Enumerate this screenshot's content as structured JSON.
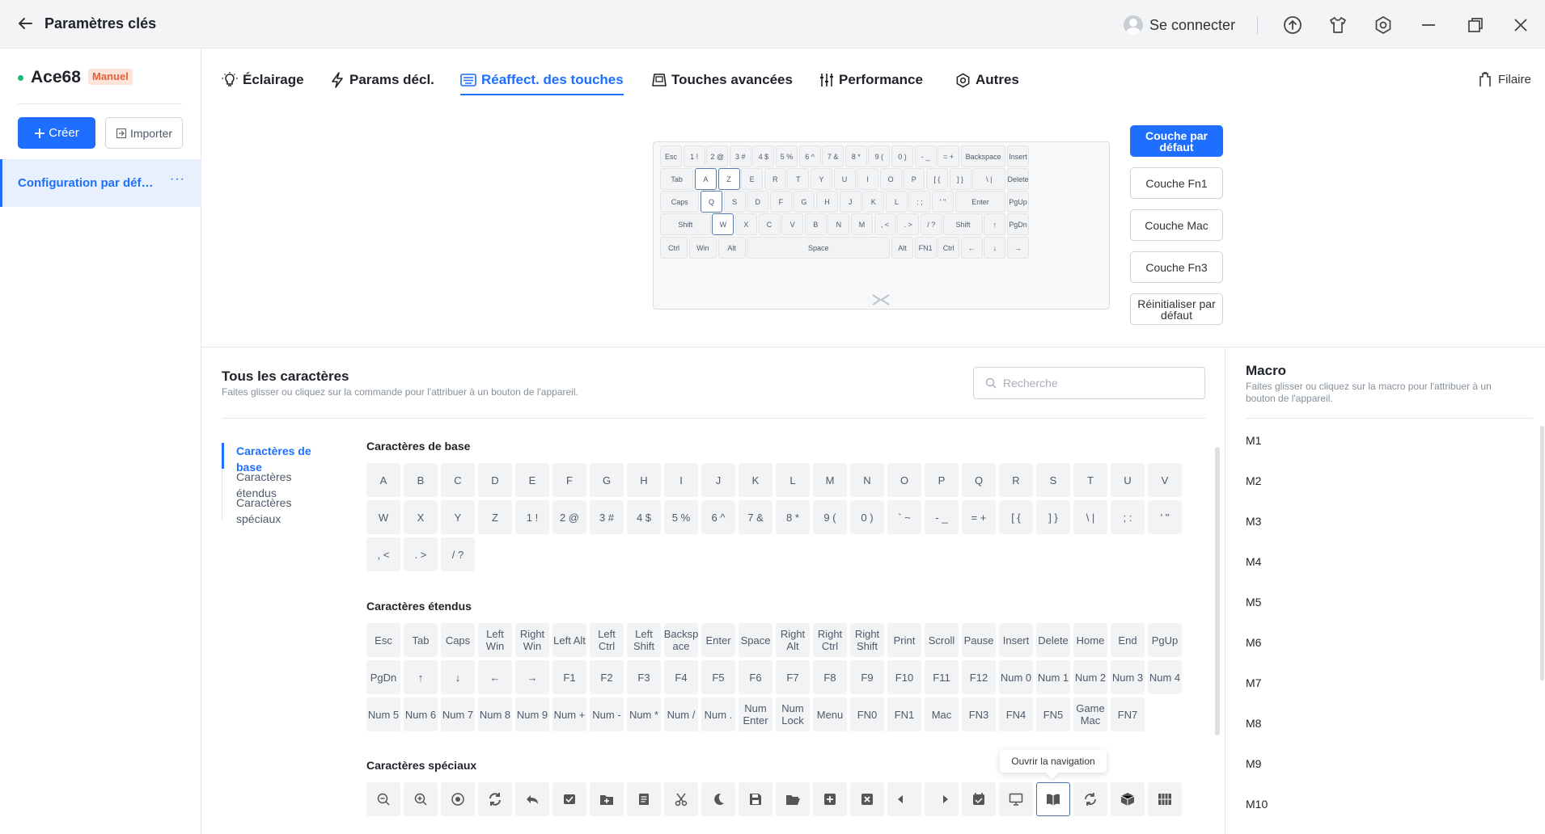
{
  "titlebar": {
    "title": "Paramètres clés",
    "user_label": "Se connecter"
  },
  "sidebar": {
    "device_name": "Ace68",
    "device_badge": "Manuel",
    "create_label": "Créer",
    "import_label": "Importer",
    "config_label": "Configuration par défaut",
    "config_more": "···"
  },
  "tabs": [
    {
      "label": "Éclairage",
      "icon": "bulb-icon"
    },
    {
      "label": "Params décl.",
      "icon": "bolt-icon"
    },
    {
      "label": "Réaffect. des touches",
      "icon": "keyboard-icon",
      "active": true
    },
    {
      "label": "Touches avancées",
      "icon": "keycap-icon"
    },
    {
      "label": "Performance",
      "icon": "sliders-icon"
    },
    {
      "label": "Autres",
      "icon": "hexagon-settings-icon"
    }
  ],
  "filaire_label": "Filaire",
  "keyboard": {
    "rows": [
      [
        "Esc",
        "1 !",
        "2 @",
        "3 #",
        "4 $",
        "5 %",
        "6 ^",
        "7 &",
        "8 *",
        "9 (",
        "0 )",
        "- _",
        "= +",
        "Backspace",
        "Insert"
      ],
      [
        "Tab",
        "A",
        "Z",
        "E",
        "R",
        "T",
        "Y",
        "U",
        "I",
        "O",
        "P",
        "[ {",
        "] }",
        "\\ |",
        "Delete"
      ],
      [
        "Caps",
        "Q",
        "S",
        "D",
        "F",
        "G",
        "H",
        "J",
        "K",
        "L",
        ": ;",
        "' \"",
        "Enter",
        "PgUp"
      ],
      [
        "Shift",
        "W",
        "X",
        "C",
        "V",
        "B",
        "N",
        "M",
        ", <",
        ". >",
        "/ ?",
        "Shift",
        "↑",
        "PgDn"
      ],
      [
        "Ctrl",
        "Win",
        "Alt",
        "Space",
        "Alt",
        "FN1",
        "Ctrl",
        "←",
        "↓",
        "→"
      ]
    ]
  },
  "layers": [
    {
      "label": "Couche par défaut",
      "active": true
    },
    {
      "label": "Couche Fn1"
    },
    {
      "label": "Couche Mac"
    },
    {
      "label": "Couche Fn3"
    },
    {
      "label": "Réinitialiser par défaut"
    }
  ],
  "chars_panel": {
    "title": "Tous les caractères",
    "subtitle": "Faites glisser ou cliquez sur la commande pour l'attribuer à un bouton de l'appareil.",
    "search_placeholder": "Recherche",
    "categories": [
      "Caractères de base",
      "Caractères étendus",
      "Caractères spéciaux"
    ],
    "basic_title": "Caractères de base",
    "basic": [
      "A",
      "B",
      "C",
      "D",
      "E",
      "F",
      "G",
      "H",
      "I",
      "J",
      "K",
      "L",
      "M",
      "N",
      "O",
      "P",
      "Q",
      "R",
      "S",
      "T",
      "U",
      "V",
      "W",
      "X",
      "Y",
      "Z",
      "1 !",
      "2 @",
      "3 #",
      "4 $",
      "5 %",
      "6 ^",
      "7 &",
      "8 *",
      "9 (",
      "0 )",
      "` ~",
      "- _",
      "= +",
      "[ {",
      "] }",
      "\\ |",
      "; :",
      "' \"",
      ", <",
      ". >",
      "/ ?"
    ],
    "extended_title": "Caractères étendus",
    "extended": [
      "Esc",
      "Tab",
      "Caps",
      "Left Win",
      "Right Win",
      "Left Alt",
      "Left Ctrl",
      "Left Shift",
      "Backsp ace",
      "Enter",
      "Space",
      "Right Alt",
      "Right Ctrl",
      "Right Shift",
      "Print",
      "Scroll",
      "Pause",
      "Insert",
      "Delete",
      "Home",
      "End",
      "PgUp",
      "PgDn",
      "↑",
      "↓",
      "←",
      "→",
      "F1",
      "F2",
      "F3",
      "F4",
      "F5",
      "F6",
      "F7",
      "F8",
      "F9",
      "F10",
      "F11",
      "F12",
      "Num 0",
      "Num 1",
      "Num 2",
      "Num 3",
      "Num 4",
      "Num 5",
      "Num 6",
      "Num 7",
      "Num 8",
      "Num 9",
      "Num +",
      "Num -",
      "Num *",
      "Num /",
      "Num .",
      "Num Enter",
      "Num Lock",
      "Menu",
      "FN0",
      "FN1",
      "Mac",
      "FN3",
      "FN4",
      "FN5",
      "Game Mac",
      "FN7"
    ],
    "special_title": "Caractères spéciaux",
    "special_icons": [
      "zoom-out-icon",
      "zoom-in-icon",
      "record-icon",
      "refresh-icon",
      "reply-icon",
      "mail-check-icon",
      "folder-add-icon",
      "notes-icon",
      "cut-icon",
      "moon-icon",
      "save-icon",
      "folder-open-icon",
      "plus-box-icon",
      "close-box-icon",
      "arrow-left-icon",
      "arrow-right-icon",
      "calendar-icon",
      "monitor-icon",
      "book-icon",
      "sync-icon",
      "box-icon",
      "grid-icon"
    ],
    "tooltip": "Ouvrir la navigation"
  },
  "macro_panel": {
    "title": "Macro",
    "subtitle": "Faites glisser ou cliquez sur la macro pour l'attribuer à un bouton de l'appareil.",
    "items": [
      "M1",
      "M2",
      "M3",
      "M4",
      "M5",
      "M6",
      "M7",
      "M8",
      "M9",
      "M10"
    ]
  },
  "colors": {
    "accent": "#1e6fff",
    "badge_bg": "#fde4d8",
    "badge_text": "#e5603a",
    "online": "#22b573"
  }
}
